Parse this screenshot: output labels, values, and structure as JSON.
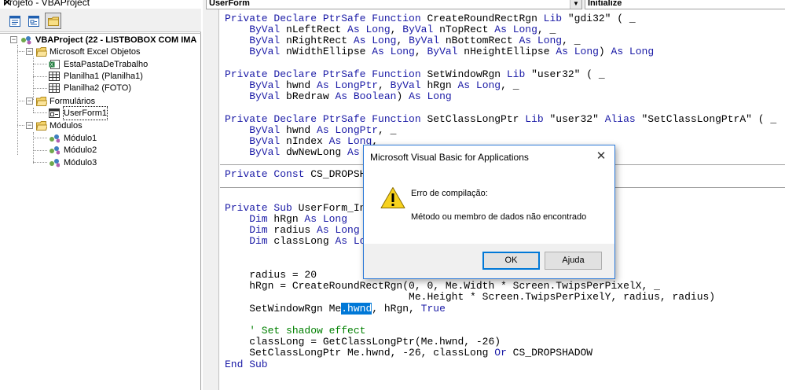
{
  "project_panel": {
    "title": "Projeto - VBAProject",
    "close_glyph": "✕",
    "toolbar": {
      "buttons": [
        {
          "icon": "view-code-icon"
        },
        {
          "icon": "view-object-icon"
        },
        {
          "icon": "toggle-folders-icon"
        }
      ]
    },
    "tree": {
      "root": "VBAProject (22 - LISTBOBOX COM IMA",
      "excel_objects": "Microsoft Excel Objetos",
      "this_workbook": "EstaPastaDeTrabalho",
      "sheet1": "Planilha1 (Planilha1)",
      "sheet2": "Planilha2 (FOTO)",
      "forms": "Formulários",
      "userform1": "UserForm1",
      "modules": "Módulos",
      "module1": "Módulo1",
      "module2": "Módulo2",
      "module3": "Módulo3",
      "minus": "−"
    }
  },
  "code_window": {
    "object_combo": "UserForm",
    "procedure_combo": "Initialize",
    "combo_arrow": "▼",
    "lines": {
      "l1": [
        "Private Declare PtrSafe Function",
        " CreateRoundRectRgn ",
        "Lib",
        " \"gdi32\" ( _"
      ],
      "l2": [
        "    ByVal",
        " nLeftRect ",
        "As Long",
        ", ",
        "ByVal",
        " nTopRect ",
        "As Long",
        ", _"
      ],
      "l3": [
        "    ByVal",
        " nRightRect ",
        "As Long",
        ", ",
        "ByVal",
        " nBottomRect ",
        "As Long",
        ", _"
      ],
      "l4": [
        "    ByVal",
        " nWidthEllipse ",
        "As Long",
        ", ",
        "ByVal",
        " nHeightEllipse ",
        "As Long",
        ") ",
        "As Long"
      ],
      "l5": [
        "Private Declare PtrSafe Function",
        " SetWindowRgn ",
        "Lib",
        " \"user32\" ( _"
      ],
      "l6": [
        "    ByVal",
        " hwnd ",
        "As LongPtr",
        ", ",
        "ByVal",
        " hRgn ",
        "As Long",
        ", _"
      ],
      "l7": [
        "    ByVal",
        " bRedraw ",
        "As Boolean",
        ") ",
        "As Long"
      ],
      "l8": [
        "Private Declare PtrSafe Function",
        " SetClassLongPtr ",
        "Lib",
        " \"user32\" ",
        "Alias",
        " \"SetClassLongPtrA\" ( _"
      ],
      "l9": [
        "    ByVal",
        " hwnd ",
        "As LongPtr",
        ", _"
      ],
      "l10": [
        "    ByVal",
        " nIndex ",
        "As Long",
        ", _"
      ],
      "l11": [
        "    ByVal",
        " dwNewLong ",
        "As"
      ],
      "l12": [
        "Private Const",
        " CS_DROPSH"
      ],
      "l13": [
        "Private Sub",
        " UserForm_In"
      ],
      "l14": [
        "    Dim",
        " hRgn ",
        "As Long"
      ],
      "l15": [
        "    Dim",
        " radius ",
        "As Long"
      ],
      "l16": [
        "    Dim",
        " classLong ",
        "As Lo"
      ],
      "l17": "    radius = 20",
      "l18": "    hRgn = CreateRoundRectRgn(0, 0, Me.Width * Screen.TwipsPerPixelX, _",
      "l19": "                              Me.Height * Screen.TwipsPerPixelY, radius, radius)",
      "l20": [
        "    SetWindowRgn Me",
        ".hwnd",
        ", hRgn, ",
        "True"
      ],
      "l21": "    ' Set shadow effect",
      "l22": "    classLong = GetClassLongPtr(Me.hwnd, -26)",
      "l23": [
        "    SetClassLongPtr Me.hwnd, -26, classLong ",
        "Or",
        " CS_DROPSHADOW"
      ],
      "l24": "End Sub"
    }
  },
  "dialog": {
    "title": "Microsoft Visual Basic for Applications",
    "close_glyph": "✕",
    "message_title": "Erro de compilação:",
    "message_body": "Método ou membro de dados não encontrado",
    "ok_label": "OK",
    "help_label": "Ajuda",
    "icon": "warning-icon"
  },
  "colors": {
    "keyword": "#1a1aa6",
    "comment": "#008000",
    "selection": "#0078d7",
    "dialog_border": "#2b79d8"
  }
}
